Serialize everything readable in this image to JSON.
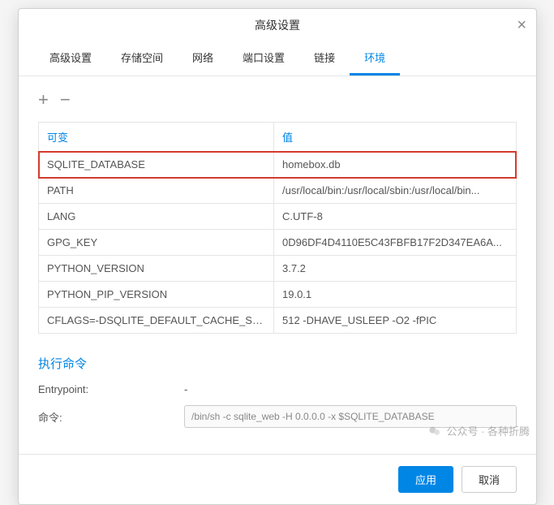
{
  "dialog": {
    "title": "高级设置",
    "close": "×"
  },
  "tabs": [
    "高级设置",
    "存储空间",
    "网络",
    "端口设置",
    "链接",
    "环境"
  ],
  "activeTab": 5,
  "tableHeader": {
    "key": "可变",
    "value": "值"
  },
  "env": [
    {
      "k": "SQLITE_DATABASE",
      "v": "homebox.db",
      "hl": true
    },
    {
      "k": "PATH",
      "v": "/usr/local/bin:/usr/local/sbin:/usr/local/bin..."
    },
    {
      "k": "LANG",
      "v": "C.UTF-8"
    },
    {
      "k": "GPG_KEY",
      "v": "0D96DF4D4110E5C43FBFB17F2D347EA6A..."
    },
    {
      "k": "PYTHON_VERSION",
      "v": "3.7.2"
    },
    {
      "k": "PYTHON_PIP_VERSION",
      "v": "19.0.1"
    },
    {
      "k": "CFLAGS=-DSQLITE_DEFAULT_CACHE_SIZE...",
      "v": "512 -DHAVE_USLEEP -O2 -fPIC"
    }
  ],
  "exec": {
    "section": "执行命令",
    "entryLabel": "Entrypoint:",
    "entryValue": "-",
    "cmdLabel": "命令:",
    "cmdValue": "/bin/sh -c sqlite_web -H 0.0.0.0 -x $SQLITE_DATABASE"
  },
  "buttons": {
    "apply": "应用",
    "cancel": "取消"
  },
  "watermark": "公众号 · 各种折腾"
}
